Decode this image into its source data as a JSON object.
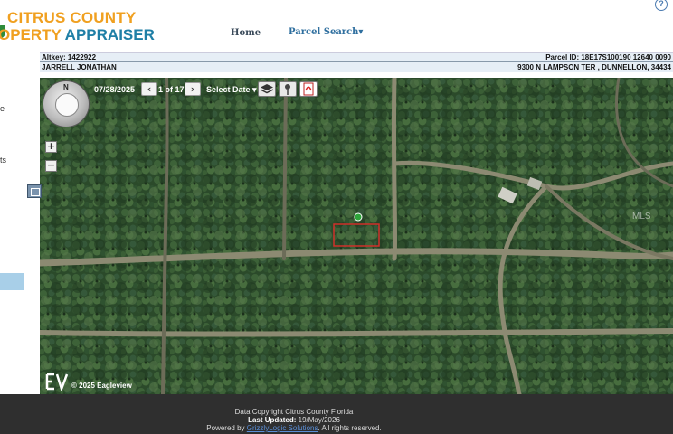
{
  "header": {
    "logo_line1": "CITRUS COUNTY",
    "logo_line2a": "OPERTY",
    "logo_line2b": " APPRAISER",
    "nav_home": "Home",
    "nav_parcel_search": "Parcel Search▾",
    "help_icon": "?"
  },
  "info": {
    "altkey": "Altkey: 1422922",
    "parcel_id": "Parcel ID: 18E17S100190 12640 0090",
    "owner": "JARRELL JONATHAN",
    "address": "9300 N LAMPSON TER , DUNNELLON, 34434"
  },
  "sidebar": {
    "text1": "e",
    "text2": "ts"
  },
  "map": {
    "date": "07/28/2025",
    "prev_label": "‹",
    "next_label": "›",
    "page_count": "1 of 17",
    "select_date": "Select Date ▾",
    "compass_n": "N",
    "zoom_in": "+",
    "zoom_out": "−",
    "copyright": "© 2025 Eagleview",
    "ev_logo": "EV",
    "watermark": "MLS",
    "parcel_outline_color": "#d0302a",
    "marker_color": "#2ea43a"
  },
  "footer": {
    "line1": "Data Copyright Citrus County Florida",
    "last_updated_label": "Last Updated:",
    "last_updated_value": " 19/May/2026",
    "powered_prefix": "Powered by",
    "powered_link": "GrizzlyLogic Solutions",
    "powered_suffix": ". All rights reserved."
  }
}
